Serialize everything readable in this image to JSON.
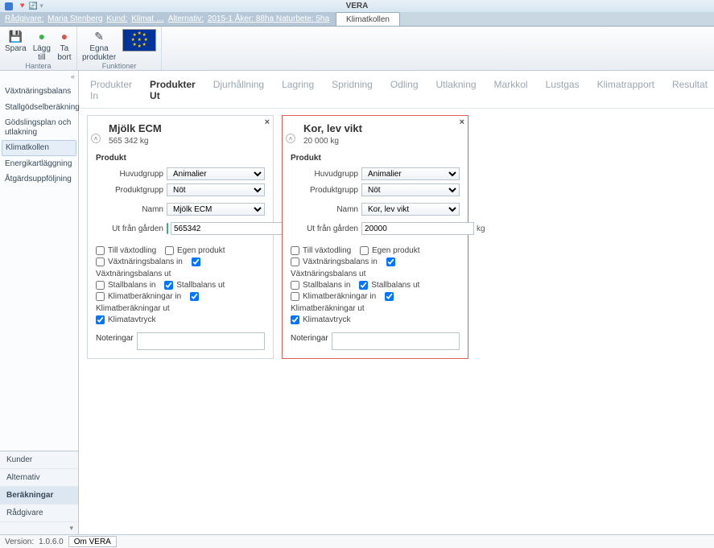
{
  "title_bar": {
    "app_hint": "VERA"
  },
  "breadcrumb": {
    "advisor_label": "Rådgivare:",
    "advisor": "Maria Stenberg",
    "customer_label": "Kund:",
    "climate_label": "Klimat …",
    "alternative_label": "Alternativ:",
    "alternative": "2015-1 Åker: 88ha Naturbete: 5ha"
  },
  "tab_active": "Klimatkollen",
  "ribbon": {
    "group_hantera": "Hantera",
    "group_funktioner": "Funktioner",
    "spara": "Spara",
    "lagg_till_1": "Lägg",
    "lagg_till_2": "till",
    "ta_bort_1": "Ta",
    "ta_bort_2": "bort",
    "egna_1": "Egna",
    "egna_2": "produkter"
  },
  "sidebar_top": {
    "items": [
      "Växtnäringsbalans",
      "Stallgödselberäkning",
      "Gödslingsplan och utlakning",
      "Klimatkollen",
      "Energikartläggning",
      "Åtgärdsuppföljning"
    ],
    "selected_index": 3
  },
  "sidebar_bottom": {
    "items": [
      "Kunder",
      "Alternativ",
      "Beräkningar",
      "Rådgivare"
    ],
    "selected_index": 2
  },
  "inner_tabs": {
    "items": [
      "Produkter In",
      "Produkter Ut",
      "Djurhållning",
      "Lagring",
      "Spridning",
      "Odling",
      "Utlakning",
      "Markkol",
      "Lustgas",
      "Klimatrapport",
      "Resultat"
    ],
    "active_index": 1
  },
  "form_labels": {
    "produkt": "Produkt",
    "huvudgrupp": "Huvudgrupp",
    "produktgrupp": "Produktgrupp",
    "namn": "Namn",
    "ut_fran": "Ut från gården",
    "kg": "kg",
    "till_vaxtodling": "Till växtodling",
    "egen_produkt": "Egen produkt",
    "vaxtnaring_in": "Växtnäringsbalans in",
    "vaxtnaring_ut": "Växtnäringsbalans ut",
    "stallbalans_in": "Stallbalans in",
    "stallbalans_ut": "Stallbalans ut",
    "klimat_in": "Klimatberäkningar in",
    "klimat_ut": "Klimatberäkningar ut",
    "klimatavtryck": "Klimatavtryck",
    "noteringar": "Noteringar"
  },
  "cards": [
    {
      "title": "Mjölk  ECM",
      "subtitle": "565 342 kg",
      "huvudgrupp": "Animalier",
      "produktgrupp": "Nöt",
      "namn": "Mjölk  ECM",
      "ut_value": "565342",
      "chk": {
        "till_vaxt": false,
        "egen": false,
        "vnb_in": false,
        "vnb_ut": true,
        "stall_in": false,
        "stall_ut": true,
        "klim_in": false,
        "klim_ut": true,
        "klimav": true
      },
      "active": false
    },
    {
      "title": "Kor, lev vikt",
      "subtitle": "20 000 kg",
      "huvudgrupp": "Animalier",
      "produktgrupp": "Nöt",
      "namn": "Kor, lev vikt",
      "ut_value": "20000",
      "chk": {
        "till_vaxt": false,
        "egen": false,
        "vnb_in": false,
        "vnb_ut": true,
        "stall_in": false,
        "stall_ut": true,
        "klim_in": false,
        "klim_ut": true,
        "klimav": true
      },
      "active": true
    }
  ],
  "status": {
    "version_label": "Version:",
    "version": "1.0.6.0",
    "about": "Om VERA"
  }
}
